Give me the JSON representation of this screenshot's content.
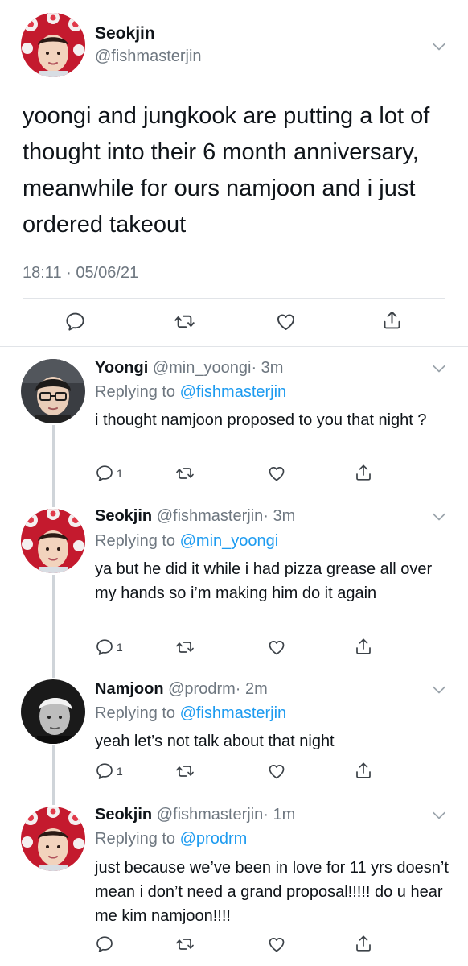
{
  "main_tweet": {
    "author_name": "Seokjin",
    "author_handle": "@fishmasterjin",
    "text": "yoongi and jungkook are putting a lot of thought into their 6 month anniversary, meanwhile for ours namjoon and i just ordered takeout",
    "timestamp": "18:11 · 05/06/21",
    "avatar_icon": "red-octopus-hat-avatar",
    "actions": [
      "reply-icon",
      "retweet-icon",
      "like-icon",
      "share-icon"
    ]
  },
  "replies": [
    {
      "name": "Yoongi",
      "handle": "@min_yoongi",
      "time": "· 3m",
      "replying_prefix": "Replying to",
      "replying_to": "@fishmasterjin",
      "text": "i thought namjoon proposed to you that night ?",
      "reply_count": "1"
    },
    {
      "name": "Seokjin",
      "handle": "@fishmasterjin",
      "time": "· 3m",
      "replying_prefix": "Replying to",
      "replying_to": "@min_yoongi",
      "text": "ya but he did it while i had pizza grease all over my hands so i’m making him do it again",
      "reply_count": "1"
    },
    {
      "name": "Namjoon",
      "handle": "@prodrm",
      "time": "· 2m",
      "replying_prefix": "Replying to",
      "replying_to": "@fishmasterjin",
      "text": "yeah let’s not talk about that night",
      "reply_count": "1"
    },
    {
      "name": "Seokjin",
      "handle": "@fishmasterjin",
      "time": "· 1m",
      "replying_prefix": "Replying to",
      "replying_to": "@prodrm",
      "text": "just because we’ve been in love for 11 yrs doesn’t mean i don’t need a grand proposal!!!!! do u hear me kim namjoon!!!!",
      "reply_count": ""
    }
  ],
  "colors": {
    "link": "#1d9bf0",
    "secondary_text": "#6e7780",
    "primary_text": "#0f1419",
    "divider": "#e1e4e8"
  }
}
